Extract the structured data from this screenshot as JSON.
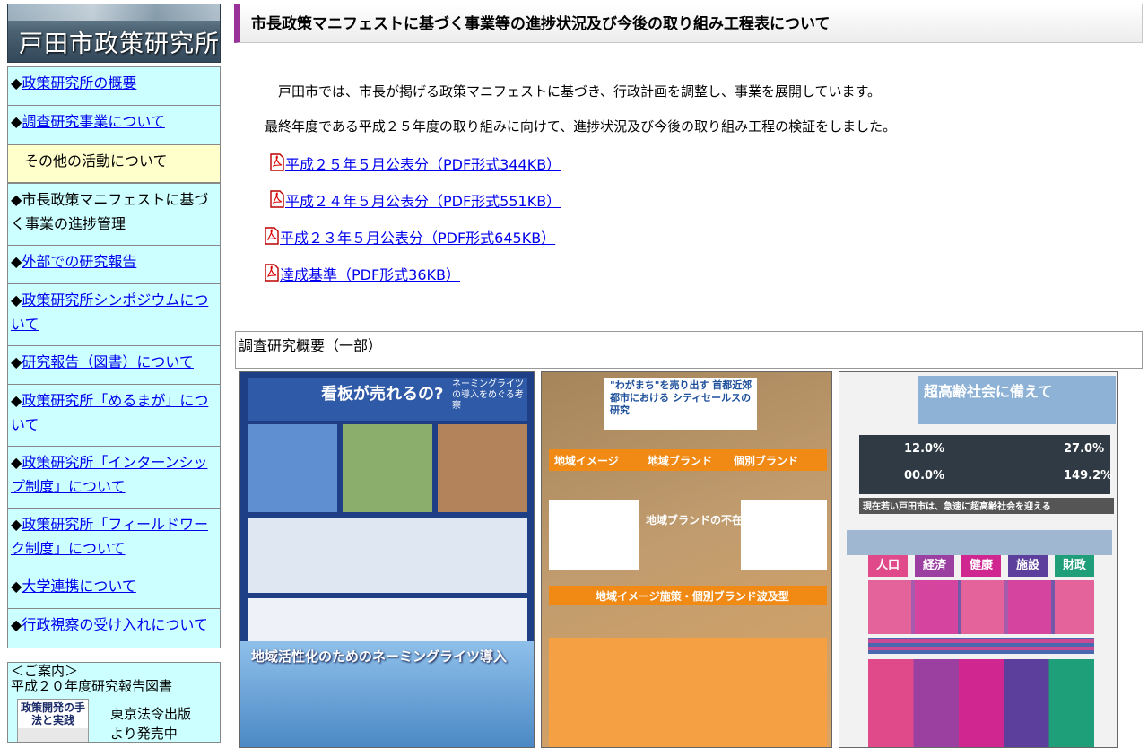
{
  "logo": {
    "text": "戸田市政策研究所"
  },
  "nav": {
    "items": [
      {
        "label": "政策研究所の概要",
        "link": true
      },
      {
        "label": "調査研究事業について",
        "link": true
      },
      {
        "label": "その他の活動について",
        "link": false,
        "sub": true
      },
      {
        "label": "市長政策マニフェストに基づく事業の進捗管理",
        "link": false
      },
      {
        "label": "外部での研究報告",
        "link": true
      },
      {
        "label": "政策研究所シンポジウムについて",
        "link": true
      },
      {
        "label": "研究報告（図書）について",
        "link": true
      },
      {
        "label": "政策研究所「めるまが」について",
        "link": true
      },
      {
        "label": "政策研究所「インターンシップ制度」について",
        "link": true
      },
      {
        "label": "政策研究所「フィールドワーク制度」について",
        "link": true
      },
      {
        "label": "大学連携について",
        "link": true
      },
      {
        "label": "行政視察の受け入れについて",
        "link": true
      }
    ],
    "diamond": "◆"
  },
  "guide": {
    "heading": "＜ご案内＞",
    "line1": "平成２０年度研究報告図書",
    "book_title": "政策開発の手法と実践",
    "publisher_line1": "東京法令出版",
    "publisher_line2": "より発売中"
  },
  "header": {
    "title": "市長政策マニフェストに基づく事業等の進捗状況及び今後の取り組み工程表について"
  },
  "intro": {
    "p1": "　戸田市では、市長が掲げる政策マニフェストに基づき、行政計画を調整し、事業を展開しています。",
    "p2": "最終年度である平成２５年度の取り組みに向けて、進捗状況及び今後の取り組み工程の検証をしました。"
  },
  "pdfs": [
    {
      "label": "平成２５年５月公表分（PDF形式344KB）"
    },
    {
      "label": "平成２４年５月公表分（PDF形式551KB）"
    },
    {
      "label": "平成２３年５月公表分（PDF形式645KB）"
    },
    {
      "label": "達成基準（PDF形式36KB）"
    }
  ],
  "summary": {
    "title": "調査研究概要（一部）"
  },
  "posters": {
    "p1": {
      "title": "看板が売れるの?",
      "subtitle": "ネーミングライツの導入をめぐる考察",
      "banner": "地域活性化のためのネーミングライツ導入"
    },
    "p2": {
      "title": "\"わがまち\"を売り出す 首都近郊都市における シティセールスの研究",
      "b1": "地域イメージ",
      "b2": "地域ブランド",
      "b3": "個別ブランド",
      "b4": "地域ブランドの不在",
      "b5": "地域イメージ施策・個別ブランド波及型"
    },
    "p3": {
      "title": "超高齢社会に備えて",
      "pct1": "12.0%",
      "pct2": "27.0%",
      "pct3": "00.0%",
      "pct4": "149.2%",
      "tags": [
        "人口",
        "経済",
        "健康",
        "施設",
        "財政"
      ],
      "headline": "現在若い戸田市は、急速に超高齢社会を迎える"
    }
  },
  "colors": {
    "nav_bg": "#ccffff",
    "nav_sub_bg": "#ffffcc",
    "header_accent": "#993399",
    "link": "#0000ee"
  }
}
